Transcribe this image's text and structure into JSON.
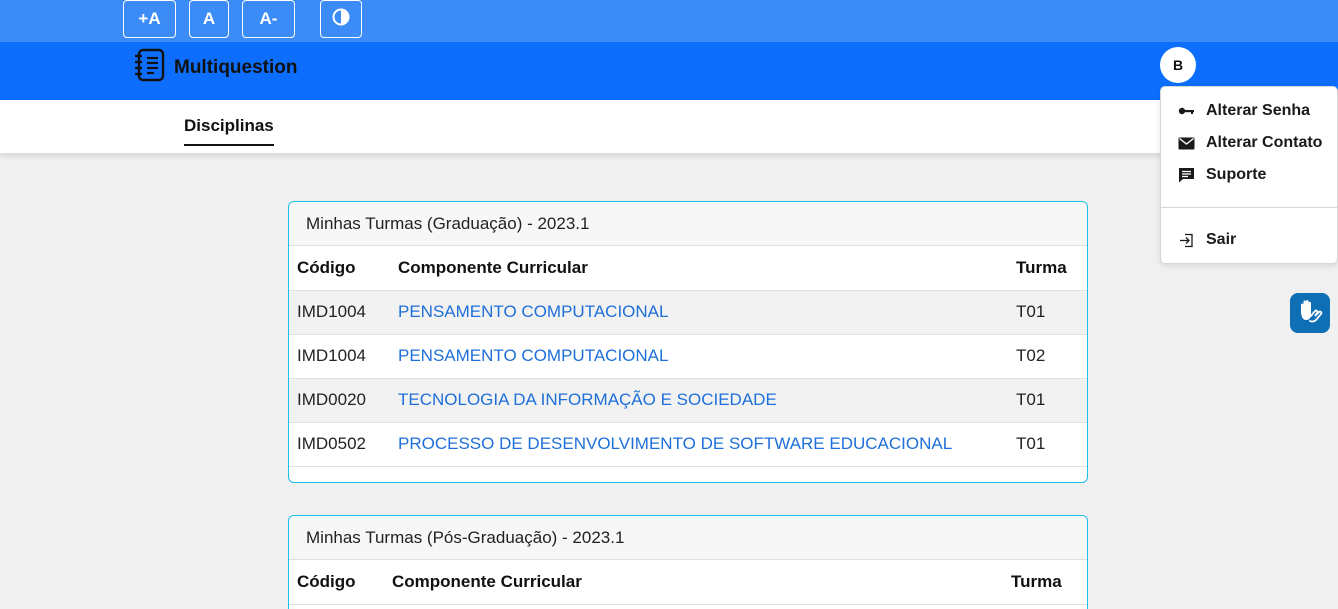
{
  "accessibility_bar": {
    "increase_font_label": "+A",
    "default_font_label": "A",
    "decrease_font_label": "A-"
  },
  "navbar": {
    "brand": "Multiquestion",
    "avatar_initial": "B"
  },
  "subnav": {
    "active_tab": "Disciplinas"
  },
  "cards": [
    {
      "title": "Minhas Turmas (Graduação) - 2023.1",
      "columns": [
        "Código",
        "Componente Curricular",
        "Turma"
      ],
      "rows": [
        {
          "codigo": "IMD1004",
          "componente": "PENSAMENTO COMPUTACIONAL",
          "turma": "T01"
        },
        {
          "codigo": "IMD1004",
          "componente": "PENSAMENTO COMPUTACIONAL",
          "turma": "T02"
        },
        {
          "codigo": "IMD0020",
          "componente": "TECNOLOGIA DA INFORMAÇÃO E SOCIEDADE",
          "turma": "T01"
        },
        {
          "codigo": "IMD0502",
          "componente": "PROCESSO DE DESENVOLVIMENTO DE SOFTWARE EDUCACIONAL",
          "turma": "T01"
        }
      ]
    },
    {
      "title": "Minhas Turmas (Pós-Graduação) - 2023.1",
      "columns": [
        "Código",
        "Componente Curricular",
        "Turma"
      ]
    }
  ],
  "user_menu": {
    "items": [
      {
        "label": "Alterar Senha",
        "icon": "key-icon"
      },
      {
        "label": "Alterar Contato",
        "icon": "envelope-icon"
      },
      {
        "label": "Suporte",
        "icon": "chat-icon"
      }
    ],
    "logout_label": "Sair",
    "logout_icon": "logout-icon"
  },
  "widgets": {
    "sign_language_icon": "vlibras-hands-icon"
  },
  "colors": {
    "accessibility_bar": "#3b8cf7",
    "navbar": "#0d6efd",
    "card_border": "#17c1e8",
    "link": "#1e6fd9"
  }
}
